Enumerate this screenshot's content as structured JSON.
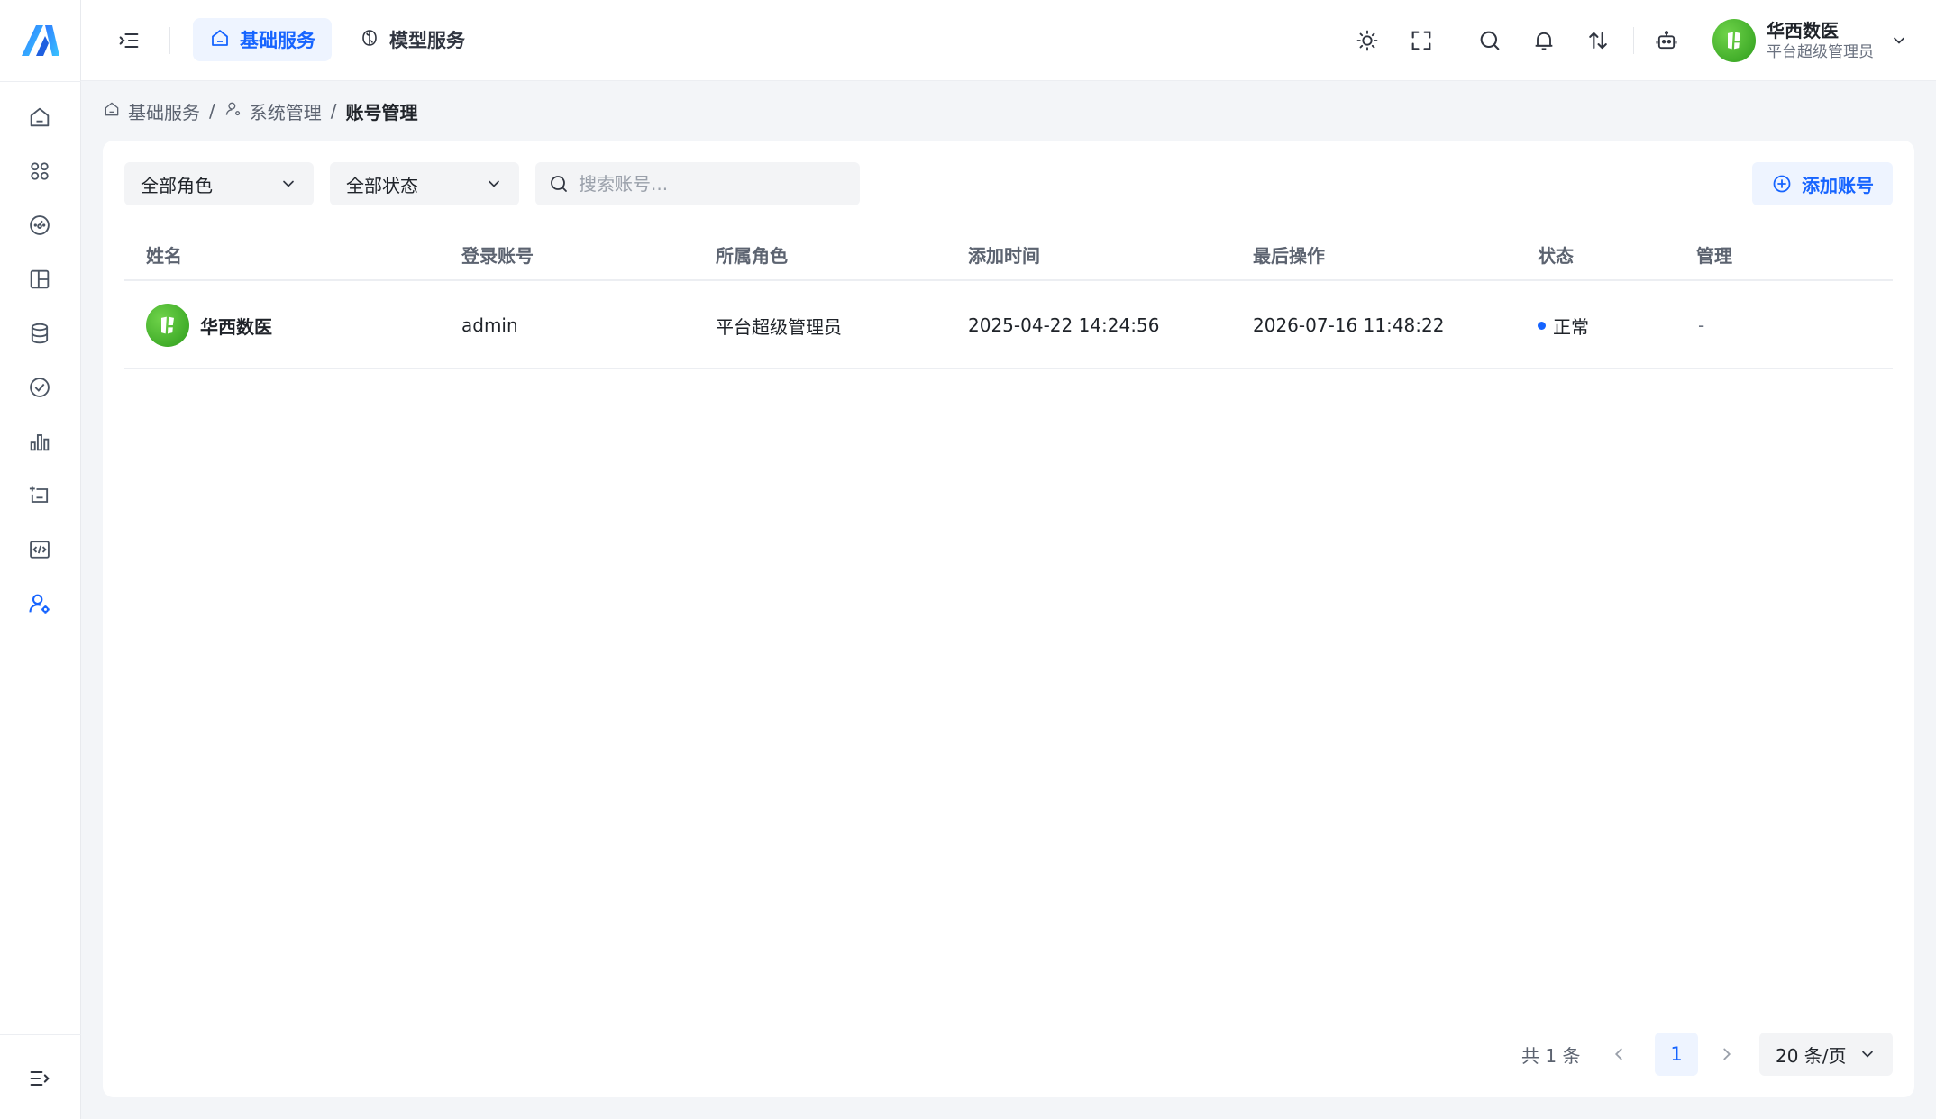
{
  "header": {
    "tabs": [
      {
        "label": "基础服务",
        "active": true,
        "icon": "home-icon"
      },
      {
        "label": "模型服务",
        "active": false,
        "icon": "brain-icon"
      }
    ],
    "user": {
      "name": "华西数医",
      "role": "平台超级管理员"
    }
  },
  "breadcrumb": {
    "root": "基础服务",
    "parent": "系统管理",
    "current": "账号管理",
    "separator": "/"
  },
  "filters": {
    "role_select": "全部角色",
    "status_select": "全部状态",
    "search_placeholder": "搜索账号...",
    "add_button": "添加账号"
  },
  "table": {
    "columns": [
      "姓名",
      "登录账号",
      "所属角色",
      "添加时间",
      "最后操作",
      "状态",
      "管理"
    ],
    "rows": [
      {
        "name": "华西数医",
        "account": "admin",
        "role": "平台超级管理员",
        "created": "2025-04-22 14:24:56",
        "last_action": "2026-07-16 11:48:22",
        "status": "正常",
        "manage": "-"
      }
    ]
  },
  "pagination": {
    "total": "共 1 条",
    "current_page": "1",
    "page_size": "20 条/页"
  },
  "colors": {
    "accent": "#1664ff",
    "accent_bg": "#eef4ff",
    "avatar_green": "#3fae24"
  }
}
